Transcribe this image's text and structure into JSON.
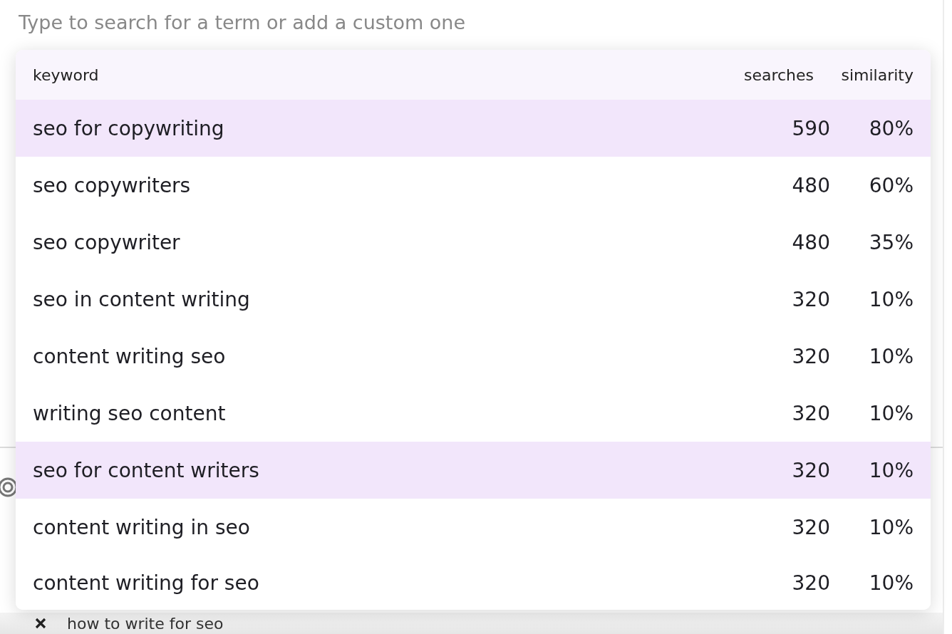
{
  "search": {
    "placeholder": "Type to search for a term or add a custom one"
  },
  "dropdown": {
    "columns": [
      "keyword",
      "searches",
      "similarity"
    ],
    "rows": [
      {
        "keyword": "seo for copywriting",
        "searches": "590",
        "similarity": "80%",
        "selected": true
      },
      {
        "keyword": "seo copywriters",
        "searches": "480",
        "similarity": "60%",
        "selected": false
      },
      {
        "keyword": "seo copywriter",
        "searches": "480",
        "similarity": "35%",
        "selected": false
      },
      {
        "keyword": "seo in content writing",
        "searches": "320",
        "similarity": "10%",
        "selected": false
      },
      {
        "keyword": "content writing seo",
        "searches": "320",
        "similarity": "10%",
        "selected": false
      },
      {
        "keyword": "writing seo content",
        "searches": "320",
        "similarity": "10%",
        "selected": false
      },
      {
        "keyword": "seo for content writers",
        "searches": "320",
        "similarity": "10%",
        "selected": true
      },
      {
        "keyword": "content writing in seo",
        "searches": "320",
        "similarity": "10%",
        "selected": false
      },
      {
        "keyword": "content writing for seo",
        "searches": "320",
        "similarity": "10%",
        "selected": false
      }
    ]
  },
  "terms": [
    {
      "label": "how to write for seo"
    }
  ]
}
